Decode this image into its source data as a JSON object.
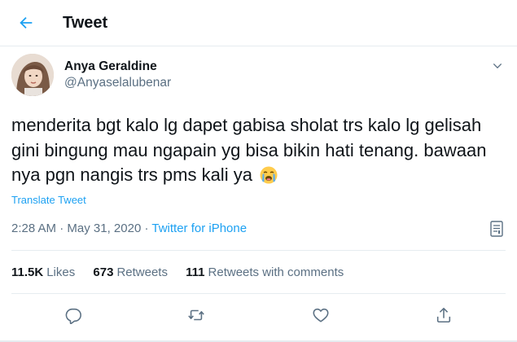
{
  "header": {
    "title": "Tweet"
  },
  "author": {
    "name": "Anya Geraldine",
    "handle": "@Anyaselalubenar"
  },
  "tweet": {
    "text": "menderita bgt kalo lg dapet gabisa sholat trs kalo lg gelisah gini bingung mau ngapain yg bisa bikin hati tenang. bawaan nya pgn nangis trs pms kali ya",
    "emoji": "loudly-crying-face"
  },
  "translate_label": "Translate Tweet",
  "meta": {
    "time": "2:28 AM",
    "separator": " · ",
    "date": "May 31, 2020",
    "source": "Twitter for iPhone"
  },
  "stats": {
    "likes_count": "11.5K",
    "likes_label": "Likes",
    "retweets_count": "673",
    "retweets_label": "Retweets",
    "quotes_count": "111",
    "quotes_label": "Retweets with comments"
  },
  "icons": {
    "back": "arrow-left-icon",
    "caret": "chevron-down-icon",
    "analytics": "analytics-icon",
    "reply": "reply-icon",
    "retweet": "retweet-icon",
    "like": "heart-icon",
    "share": "share-icon"
  },
  "colors": {
    "accent": "#1da1f2",
    "text_primary": "#0f1419",
    "text_secondary": "#5b7083",
    "border": "#e6ecf0"
  }
}
